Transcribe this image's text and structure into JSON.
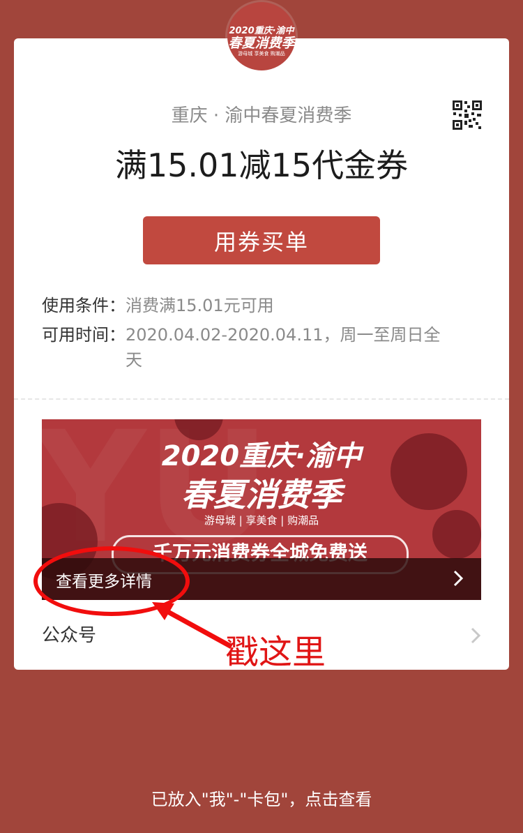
{
  "logo": {
    "line1": "2020重庆·渝中",
    "line2": "春夏消费季",
    "line3": "游母城  享美食  购潮品"
  },
  "coupon": {
    "subtitle": "重庆 · 渝中春夏消费季",
    "title": "满15.01减15代金券",
    "use_button": "用券买单",
    "condition_label": "使用条件：",
    "condition_value": "消费满15.01元可用",
    "time_label": "可用时间：",
    "time_value": "2020.04.02-2020.04.11，周一至周日全天"
  },
  "banner": {
    "line1": "2020重庆·渝中",
    "line2": "春夏消费季",
    "line3": "游母城 | 享美食 | 购潮品",
    "pill": "千万元消费券全城免费送",
    "more_link": "查看更多详情"
  },
  "public_account": {
    "label": "公众号"
  },
  "annotation": {
    "text": "戳这里",
    "color": "#f10d0d"
  },
  "footer": {
    "text": "已放入\"我\"-\"卡包\"，点击查看"
  },
  "colors": {
    "background": "#a1453b",
    "button": "#c1493f",
    "banner": "#b3393d"
  },
  "icons": {
    "qr": "qr-code-icon",
    "chevron": "chevron-right-icon"
  }
}
